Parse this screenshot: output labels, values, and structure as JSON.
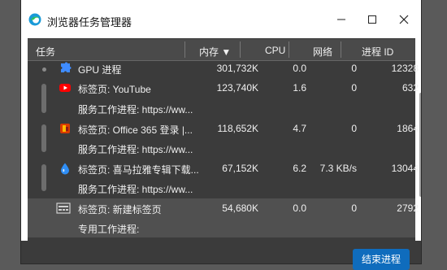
{
  "window": {
    "title": "浏览器任务管理器"
  },
  "columns": {
    "task": "任务",
    "memory": "内存 ▼",
    "cpu": "CPU",
    "network": "网络",
    "pid": "进程 ID"
  },
  "rows": [
    {
      "task": "GPU 进程",
      "memory": "301,732K",
      "cpu": "0.0",
      "network": "0",
      "pid": "12328",
      "icon": "puzzle-icon"
    },
    {
      "task": "标签页: YouTube",
      "memory": "123,740K",
      "cpu": "1.6",
      "network": "0",
      "pid": "632",
      "icon": "youtube-icon"
    },
    {
      "task": "服务工作进程: https://ww...",
      "memory": "",
      "cpu": "",
      "network": "",
      "pid": "",
      "icon": ""
    },
    {
      "task": "标签页: Office 365 登录 |...",
      "memory": "118,652K",
      "cpu": "4.7",
      "network": "0",
      "pid": "1864",
      "icon": "office-icon"
    },
    {
      "task": "服务工作进程: https://ww...",
      "memory": "",
      "cpu": "",
      "network": "",
      "pid": "",
      "icon": ""
    },
    {
      "task": "标签页: 喜马拉雅专辑下载...",
      "memory": "67,152K",
      "cpu": "6.2",
      "network": "7.3 KB/s",
      "pid": "13044",
      "icon": "droplet-icon"
    },
    {
      "task": "服务工作进程: https://ww...",
      "memory": "",
      "cpu": "",
      "network": "",
      "pid": "",
      "icon": ""
    },
    {
      "task": "标签页: 新建标签页",
      "memory": "54,680K",
      "cpu": "0.0",
      "network": "0",
      "pid": "2792",
      "icon": "new-tab-icon"
    },
    {
      "task": "专用工作进程:",
      "memory": "",
      "cpu": "",
      "network": "",
      "pid": "",
      "icon": ""
    }
  ],
  "footer": {
    "end_process_label": "结束进程"
  },
  "colors": {
    "accent": "#0f6cbd",
    "panel": "#3b3b3b",
    "header": "#4a4a4a",
    "selected": "#505050"
  }
}
